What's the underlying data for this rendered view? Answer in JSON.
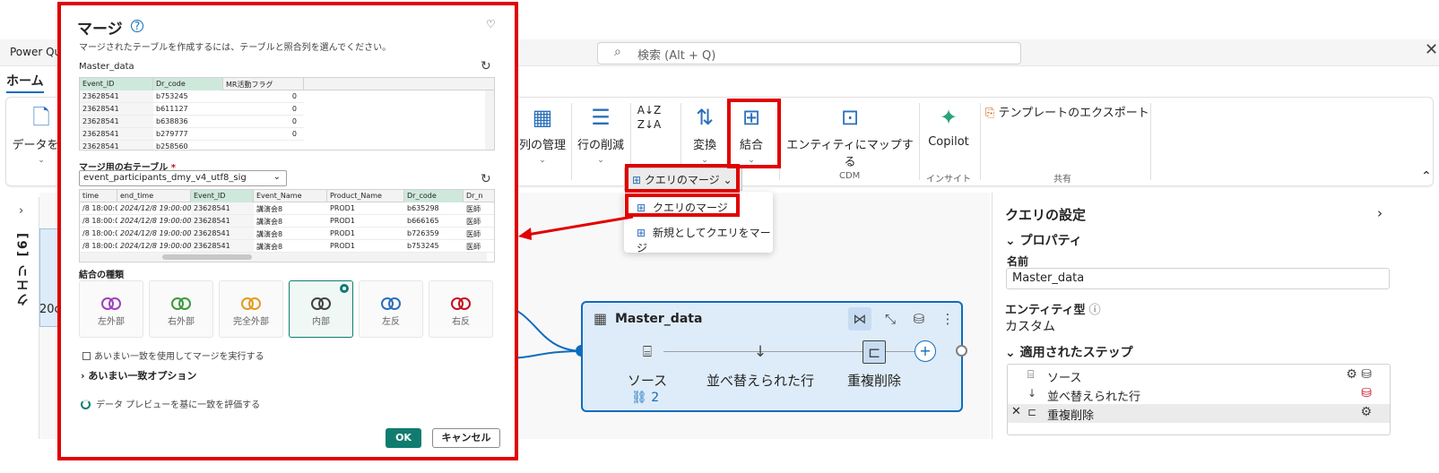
{
  "topbar": {
    "app_title": "Power Qu",
    "search_placeholder": "検索 (Alt + Q)",
    "close": "✕"
  },
  "tabs": {
    "home": "ホーム"
  },
  "ribbon": {
    "get_data": "データを取",
    "manage_columns": "列の管理",
    "reduce_rows": "行の削減",
    "sort_az": "Z↓A",
    "transform": "変換",
    "combine": "結合",
    "map_entity": "エンティティにマップする",
    "copilot": "Copilot",
    "export_template": "テンプレートのエクスポート",
    "group_cdm": "CDM",
    "group_insight": "インサイト",
    "group_share": "共有"
  },
  "dropdown": {
    "button": "クエリのマージ",
    "item1": "クエリのマージ",
    "item2": "新規としてクエリをマージ"
  },
  "queries_panel": {
    "title": "クエリ [6]",
    "ghost_text": "20c"
  },
  "node": {
    "title": "Master_data",
    "steps": [
      "ソース",
      "並べ替えられた行",
      "重複削除"
    ],
    "link_count": "2"
  },
  "settings": {
    "title": "クエリの設定",
    "properties": "プロパティ",
    "name_label": "名前",
    "name_value": "Master_data",
    "entity_type_label": "エンティティ型",
    "entity_type_value": "カスタム",
    "applied_steps": "適用されたステップ",
    "steps": [
      "ソース",
      "並べ替えられた行",
      "重複削除"
    ]
  },
  "dialog": {
    "title": "マージ",
    "description": "マージされたテーブルを作成するには、テーブルと照合列を選んでください。",
    "left_table": "Master_data",
    "left_headers": [
      "Event_ID",
      "Dr_code",
      "MR活動フラグ"
    ],
    "left_rows": [
      [
        "23628541",
        "b753245",
        "0"
      ],
      [
        "23628541",
        "b611127",
        "0"
      ],
      [
        "23628541",
        "b638836",
        "0"
      ],
      [
        "23628541",
        "b279777",
        "0"
      ],
      [
        "23628541",
        "b258560",
        ""
      ]
    ],
    "right_label": "マージ用の右テーブル",
    "right_required": "*",
    "right_select": "event_participants_dmy_v4_utf8_sig",
    "right_headers": [
      "time",
      "end_time",
      "Event_ID",
      "Event_Name",
      "Product_Name",
      "Dr_code",
      "Dr_n"
    ],
    "right_rows": [
      [
        "/8 18:00:00",
        "2024/12/8 19:00:00",
        "23628541",
        "講演会8",
        "PROD1",
        "b635298",
        "医師"
      ],
      [
        "/8 18:00:00",
        "2024/12/8 19:00:00",
        "23628541",
        "講演会8",
        "PROD1",
        "b666165",
        "医師"
      ],
      [
        "/8 18:00:00",
        "2024/12/8 19:00:00",
        "23628541",
        "講演会8",
        "PROD1",
        "b726359",
        "医師"
      ],
      [
        "/8 18:00:00",
        "2024/12/8 19:00:00",
        "23628541",
        "講演会8",
        "PROD1",
        "b753245",
        "医師"
      ]
    ],
    "join_label": "結合の種類",
    "join_types": [
      "左外部",
      "右外部",
      "完全外部",
      "内部",
      "左反",
      "右反"
    ],
    "fuzzy_checkbox": "あいまい一致を使用してマージを実行する",
    "fuzzy_options": "あいまい一致オプション",
    "evaluate": "データ プレビューを基に一致を評価する",
    "ok": "OK",
    "cancel": "キャンセル"
  },
  "colors": {
    "accent": "#0f6cbd",
    "highlight": "#e00000",
    "ok_button": "#107c6f"
  }
}
